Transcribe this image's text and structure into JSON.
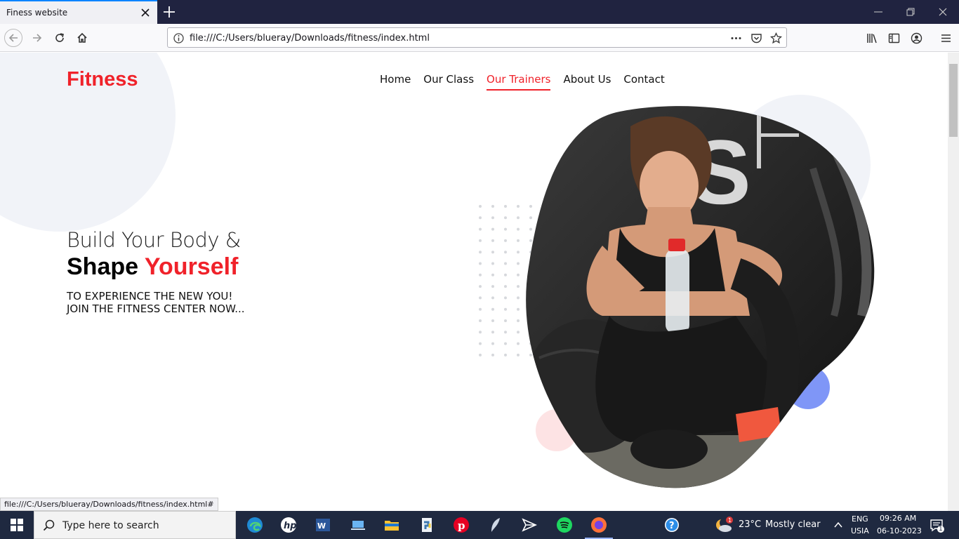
{
  "browser": {
    "tab_title": "Finess website",
    "url": "file:///C:/Users/blueray/Downloads/fitness/index.html",
    "status_url": "file:///C:/Users/blueray/Downloads/fitness/index.html#"
  },
  "site": {
    "logo": "Fitness",
    "nav": [
      {
        "label": "Home",
        "active": false
      },
      {
        "label": "Our Class",
        "active": false
      },
      {
        "label": "Our Trainers",
        "active": true
      },
      {
        "label": "About Us",
        "active": false
      },
      {
        "label": "Contact",
        "active": false
      }
    ],
    "hero": {
      "line1": "Build Your Body &",
      "line2_black": "Shape ",
      "line2_red": "Yourself",
      "sub1": "TO EXPERIENCE THE NEW YOU!",
      "sub2": "JOIN THE FITNESS CENTER NOW..."
    },
    "colors": {
      "accent": "#f0222a",
      "soft_blue": "#7f96f7",
      "soft_pink": "#fde3e4",
      "soft_gray": "#f1f3f8"
    }
  },
  "taskbar": {
    "search_placeholder": "Type here to search",
    "weather_temp": "23°C",
    "weather_text": "Mostly clear",
    "lang1": "ENG",
    "lang2": "USIA",
    "time": "09:26 AM",
    "date": "06-10-2023",
    "notification_count": "1",
    "weather_badge": "1",
    "apps": [
      "edge-icon",
      "hp-icon",
      "word-icon",
      "laptop-icon",
      "file-explorer-icon",
      "python-icon",
      "pinterest-icon",
      "feather-icon",
      "send-icon",
      "spotify-icon",
      "firefox-icon",
      "help-icon"
    ]
  }
}
